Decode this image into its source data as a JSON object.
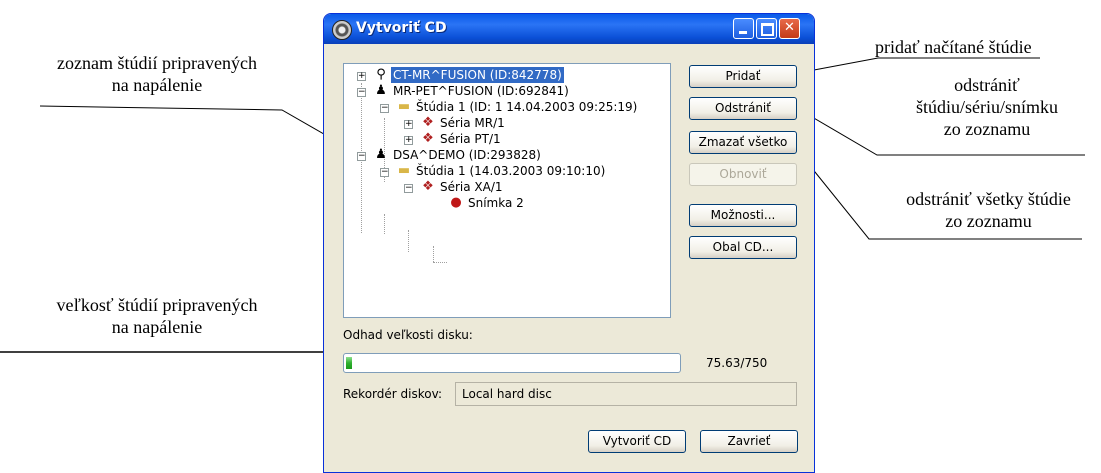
{
  "annotations": {
    "left_top": [
      "zoznam štúdií pripravených",
      "na napálenie"
    ],
    "left_bottom": [
      "veľkosť štúdií pripravených",
      "na napálenie"
    ],
    "right_add": "pridať načítané štúdie",
    "right_remove": [
      "odstrániť",
      "štúdiu/sériu/snímku",
      "zo zoznamu"
    ],
    "right_clear": [
      "odstrániť všetky štúdie",
      "zo zoznamu"
    ]
  },
  "window": {
    "title": "Vytvoriť CD",
    "buttons": {
      "minimize": "minimize-icon",
      "maximize": "maximize-icon",
      "close": "close-icon"
    }
  },
  "tree": {
    "items": [
      {
        "label": "CT-MR^FUSION (ID:842778)",
        "icon": "patient-icon",
        "expander": "+"
      },
      {
        "label": "MR-PET^FUSION (ID:692841)",
        "icon": "patient-icon",
        "expander": "−"
      },
      {
        "label": "Štúdia 1 (ID: 1 14.04.2003 09:25:19)",
        "icon": "folder-icon",
        "expander": "−"
      },
      {
        "label": "Séria MR/1",
        "icon": "series-icon",
        "expander": "+"
      },
      {
        "label": "Séria PT/1",
        "icon": "series-icon",
        "expander": "+"
      },
      {
        "label": "DSA^DEMO (ID:293828)",
        "icon": "patient-icon",
        "expander": "−"
      },
      {
        "label": "Štúdia 1 (14.03.2003 09:10:10)",
        "icon": "folder-icon",
        "expander": "−"
      },
      {
        "label": "Séria XA/1",
        "icon": "series-icon",
        "expander": "−"
      },
      {
        "label": "Snímka 2",
        "icon": "image-icon",
        "expander": ""
      }
    ]
  },
  "side_buttons": {
    "add": "Pridať",
    "remove": "Odstrániť",
    "clear_all": "Zmazať všetko",
    "refresh": "Obnoviť",
    "options": "Možnosti...",
    "cd_cover": "Obal CD..."
  },
  "disk": {
    "label": "Odhad veľkosti disku:",
    "value_text": "75.63/750",
    "fill_fraction": 0.1
  },
  "recorder": {
    "label": "Rekordér diskov:",
    "value": "Local hard disc"
  },
  "bottom_buttons": {
    "create": "Vytvoriť CD",
    "close": "Zavrieť"
  },
  "colors": {
    "titlebar": "#0a5ae8",
    "selection": "#316ac5",
    "progress": "#2fb02f",
    "close_button": "#c43a16"
  }
}
